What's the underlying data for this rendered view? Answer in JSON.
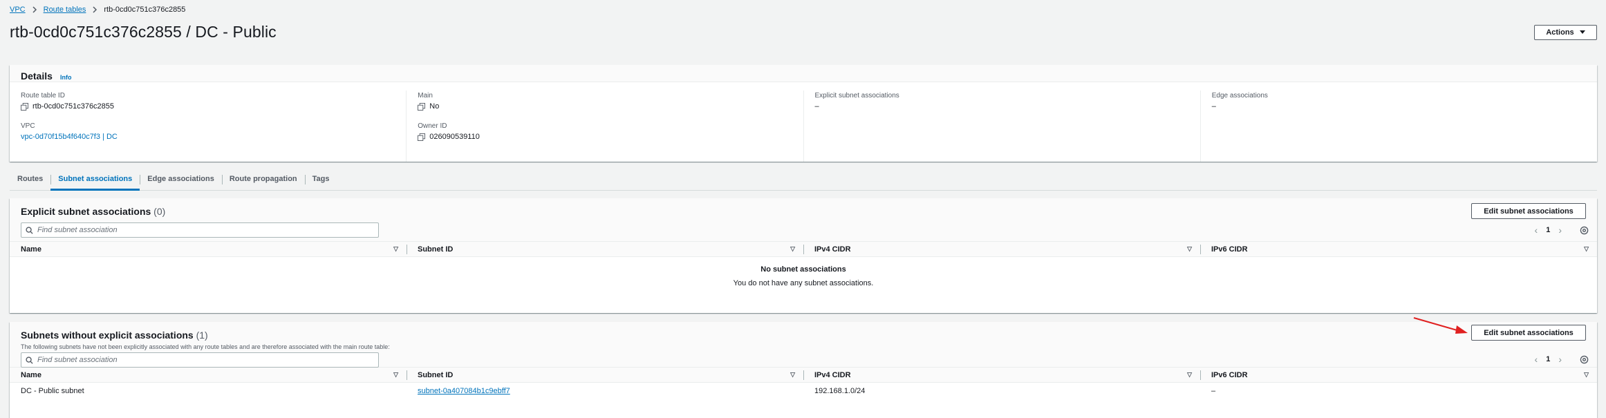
{
  "breadcrumb": {
    "items": [
      "VPC",
      "Route tables"
    ],
    "current": "rtb-0cd0c751c376c2855"
  },
  "page": {
    "title": "rtb-0cd0c751c376c2855 / DC - Public",
    "actions_label": "Actions"
  },
  "details": {
    "title": "Details",
    "info": "Info",
    "route_table_id_label": "Route table ID",
    "route_table_id": "rtb-0cd0c751c376c2855",
    "vpc_label": "VPC",
    "vpc": "vpc-0d70f15b4f640c7f3 | DC",
    "main_label": "Main",
    "main": "No",
    "owner_label": "Owner ID",
    "owner": "026090539110",
    "explicit_label": "Explicit subnet associations",
    "explicit_value": "–",
    "edge_label": "Edge associations",
    "edge_value": "–"
  },
  "tabs": [
    "Routes",
    "Subnet associations",
    "Edge associations",
    "Route propagation",
    "Tags"
  ],
  "explicit": {
    "title": "Explicit subnet associations",
    "count": "(0)",
    "edit_label": "Edit subnet associations",
    "search_placeholder": "Find subnet association",
    "page": "1",
    "columns": [
      "Name",
      "Subnet ID",
      "IPv4 CIDR",
      "IPv6 CIDR"
    ],
    "empty_title": "No subnet associations",
    "empty_text": "You do not have any subnet associations."
  },
  "without": {
    "title": "Subnets without explicit associations",
    "count": "(1)",
    "description": "The following subnets have not been explicitly associated with any route tables and are therefore associated with the main route table:",
    "edit_label": "Edit subnet associations",
    "search_placeholder": "Find subnet association",
    "page": "1",
    "columns": [
      "Name",
      "Subnet ID",
      "IPv4 CIDR",
      "IPv6 CIDR"
    ],
    "rows": [
      {
        "name": "DC - Public subnet",
        "subnet_id": "subnet-0a407084b1c9ebff7",
        "ipv4": "192.168.1.0/24",
        "ipv6": "–"
      }
    ]
  },
  "colors": {
    "link": "#0073bb",
    "arrow": "#e02020"
  }
}
